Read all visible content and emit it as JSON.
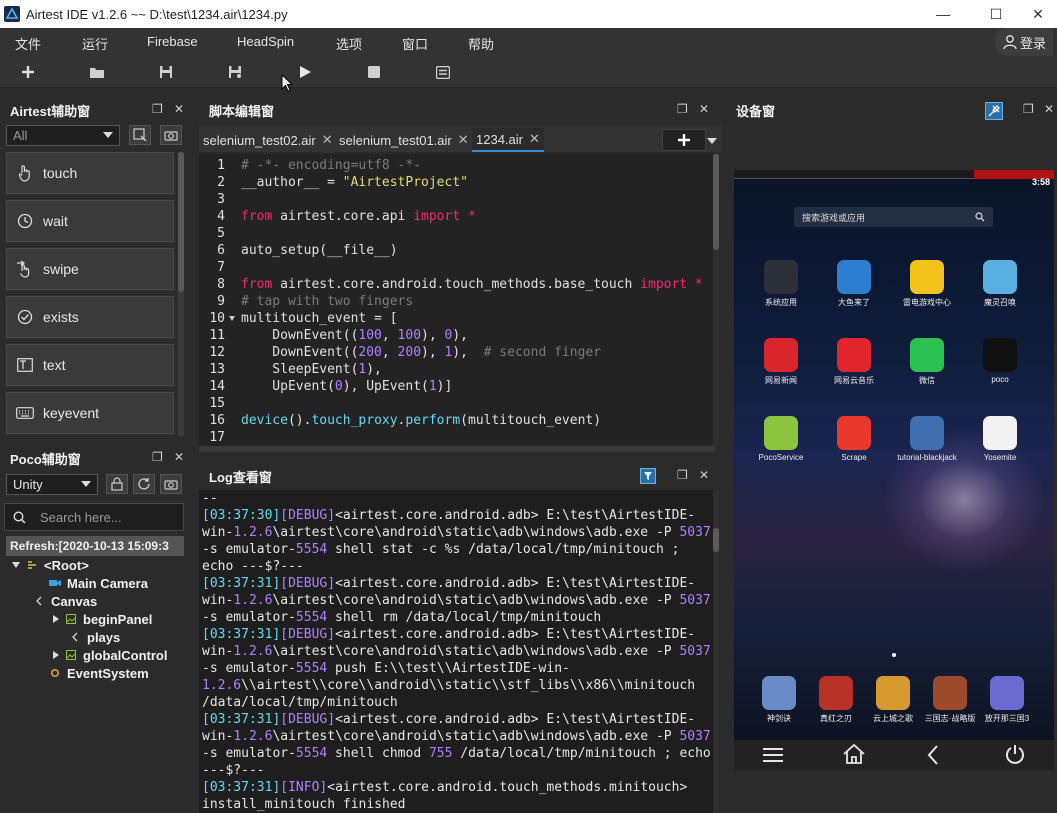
{
  "window": {
    "title": "Airtest IDE v1.2.6 ~~ D:\\test\\1234.air\\1234.py"
  },
  "menu": [
    "文件",
    "运行",
    "Firebase",
    "HeadSpin",
    "选项",
    "窗口",
    "帮助"
  ],
  "login_label": "登录",
  "airtest_panel": {
    "title": "Airtest辅助窗",
    "filter_value": "All",
    "buttons": [
      "touch",
      "wait",
      "swipe",
      "exists",
      "text",
      "keyevent"
    ]
  },
  "poco_panel": {
    "title": "Poco辅助窗",
    "engine_value": "Unity",
    "search_placeholder": "Search here...",
    "refresh_text": "Refresh:[2020-10-13 15:09:3",
    "tree": [
      "<Root>",
      "Main Camera",
      "Canvas",
      "beginPanel",
      "plays",
      "globalControl",
      "EventSystem"
    ]
  },
  "editor": {
    "title": "脚本编辑窗",
    "tabs": [
      "selenium_test02.air",
      "selenium_test01.air",
      "1234.air"
    ],
    "line_numbers": [
      "1",
      "2",
      "3",
      "4",
      "5",
      "6",
      "7",
      "8",
      "9",
      "10",
      "11",
      "12",
      "13",
      "14",
      "15",
      "16",
      "17"
    ],
    "lines": [
      "# -*- encoding=utf8 -*-",
      "__author__ = \"AirtestProject\"",
      "",
      "from airtest.core.api import *",
      "",
      "auto_setup(__file__)",
      "",
      "from airtest.core.android.touch_methods.base_touch import *",
      "# tap with two fingers",
      "multitouch_event = [",
      "    DownEvent((100, 100), 0),",
      "    DownEvent((200, 200), 1),  # second finger",
      "    SleepEvent(1),",
      "    UpEvent(0), UpEvent(1)]",
      "",
      "device().touch_proxy.perform(multitouch_event)",
      ""
    ]
  },
  "log": {
    "title": "Log查看窗",
    "lines": [
      "--",
      "[03:37:30][DEBUG]<airtest.core.android.adb> E:\\test\\AirtestIDE-",
      "win-1.2.6\\airtest\\core\\android\\static\\adb\\windows\\adb.exe -P 5037",
      "-s emulator-5554 shell stat -c %s /data/local/tmp/minitouch ;",
      "echo ---$?---",
      "[03:37:31][DEBUG]<airtest.core.android.adb> E:\\test\\AirtestIDE-",
      "win-1.2.6\\airtest\\core\\android\\static\\adb\\windows\\adb.exe -P 5037",
      "-s emulator-5554 shell rm /data/local/tmp/minitouch",
      "[03:37:31][DEBUG]<airtest.core.android.adb> E:\\test\\AirtestIDE-",
      "win-1.2.6\\airtest\\core\\android\\static\\adb\\windows\\adb.exe -P 5037",
      "-s emulator-5554 push E:\\\\test\\\\AirtestIDE-win-",
      "1.2.6\\\\airtest\\\\core\\\\android\\\\static\\\\stf_libs\\\\x86\\\\minitouch",
      "/data/local/tmp/minitouch",
      "[03:37:31][DEBUG]<airtest.core.android.adb> E:\\test\\AirtestIDE-",
      "win-1.2.6\\airtest\\core\\android\\static\\adb\\windows\\adb.exe -P 5037",
      "-s emulator-5554 shell chmod 755 /data/local/tmp/minitouch ; echo",
      "---$?---",
      "[03:37:31][INFO]<airtest.core.android.touch_methods.minitouch>",
      "install_minitouch finished"
    ]
  },
  "device": {
    "title": "设备窗",
    "status_time": "3:58",
    "search_placeholder": "搜索游戏或应用",
    "apps": [
      {
        "label": "系统应用",
        "color": "#2a2f3a"
      },
      {
        "label": "大鱼来了",
        "color": "#2c7fd0"
      },
      {
        "label": "雷电游戏中心",
        "color": "#f3c21b"
      },
      {
        "label": "魔灵召唤",
        "color": "#5ab0e0"
      },
      {
        "label": "网易新闻",
        "color": "#d8262c"
      },
      {
        "label": "网易云音乐",
        "color": "#e0262c"
      },
      {
        "label": "微信",
        "color": "#2bc24f"
      },
      {
        "label": "poco",
        "color": "#111111"
      },
      {
        "label": "PocoService",
        "color": "#8cc43d"
      },
      {
        "label": "Scrape",
        "color": "#e8392c"
      },
      {
        "label": "tutorial-blackjack",
        "color": "#3f6fb0"
      },
      {
        "label": "Yosemite",
        "color": "#f2f2f2"
      }
    ],
    "dock": [
      {
        "label": "神剑诀",
        "color": "#6a8bc8"
      },
      {
        "label": "真红之刃",
        "color": "#b8322a"
      },
      {
        "label": "云上城之歌",
        "color": "#d69a2f"
      },
      {
        "label": "三国志·战略版",
        "color": "#9c4a2a"
      },
      {
        "label": "放开那三国3",
        "color": "#6a6ad0"
      }
    ]
  }
}
